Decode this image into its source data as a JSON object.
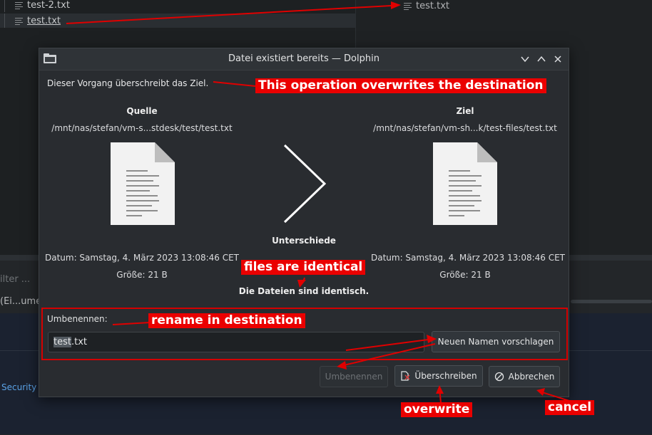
{
  "background": {
    "tree_files": [
      "test-2.txt",
      "test.txt"
    ],
    "right_pane_file": "test.txt",
    "filter_text": "ilter ...",
    "status_text": "(Ei...umen",
    "security_link": "Security"
  },
  "dialog": {
    "title": "Datei existiert bereits — Dolphin",
    "message": "Dieser Vorgang überschreibt das Ziel.",
    "source": {
      "heading": "Quelle",
      "path": "/mnt/nas/stefan/vm-s...stdesk/test/test.txt",
      "date": "Datum: Samstag, 4. März 2023 13:08:46 CET",
      "size": "Größe: 21 B"
    },
    "dest": {
      "heading": "Ziel",
      "path": "/mnt/nas/stefan/vm-sh...k/test-files/test.txt",
      "date": "Datum: Samstag, 4. März 2023 13:08:46 CET",
      "size": "Größe: 21 B"
    },
    "differences_label": "Unterschiede",
    "identical_text": "Die Dateien sind identisch.",
    "rename_label": "Umbenennen:",
    "rename_value_selected": "test",
    "rename_value_rest": ".txt",
    "suggest_button": "Neuen Namen vorschlagen",
    "rename_button": "Umbenennen",
    "overwrite_button": "Überschreiben",
    "cancel_button": "Abbrechen"
  },
  "annotations": {
    "overwrite_destination": "This operation overwrites the destination",
    "files_identical": "files are identical",
    "rename_destination": "rename in destination",
    "overwrite": "overwrite",
    "cancel": "cancel"
  },
  "colors": {
    "annotation_red": "#ea0000",
    "dialog_bg": "#292c30",
    "link_blue": "#5aa2e6"
  }
}
